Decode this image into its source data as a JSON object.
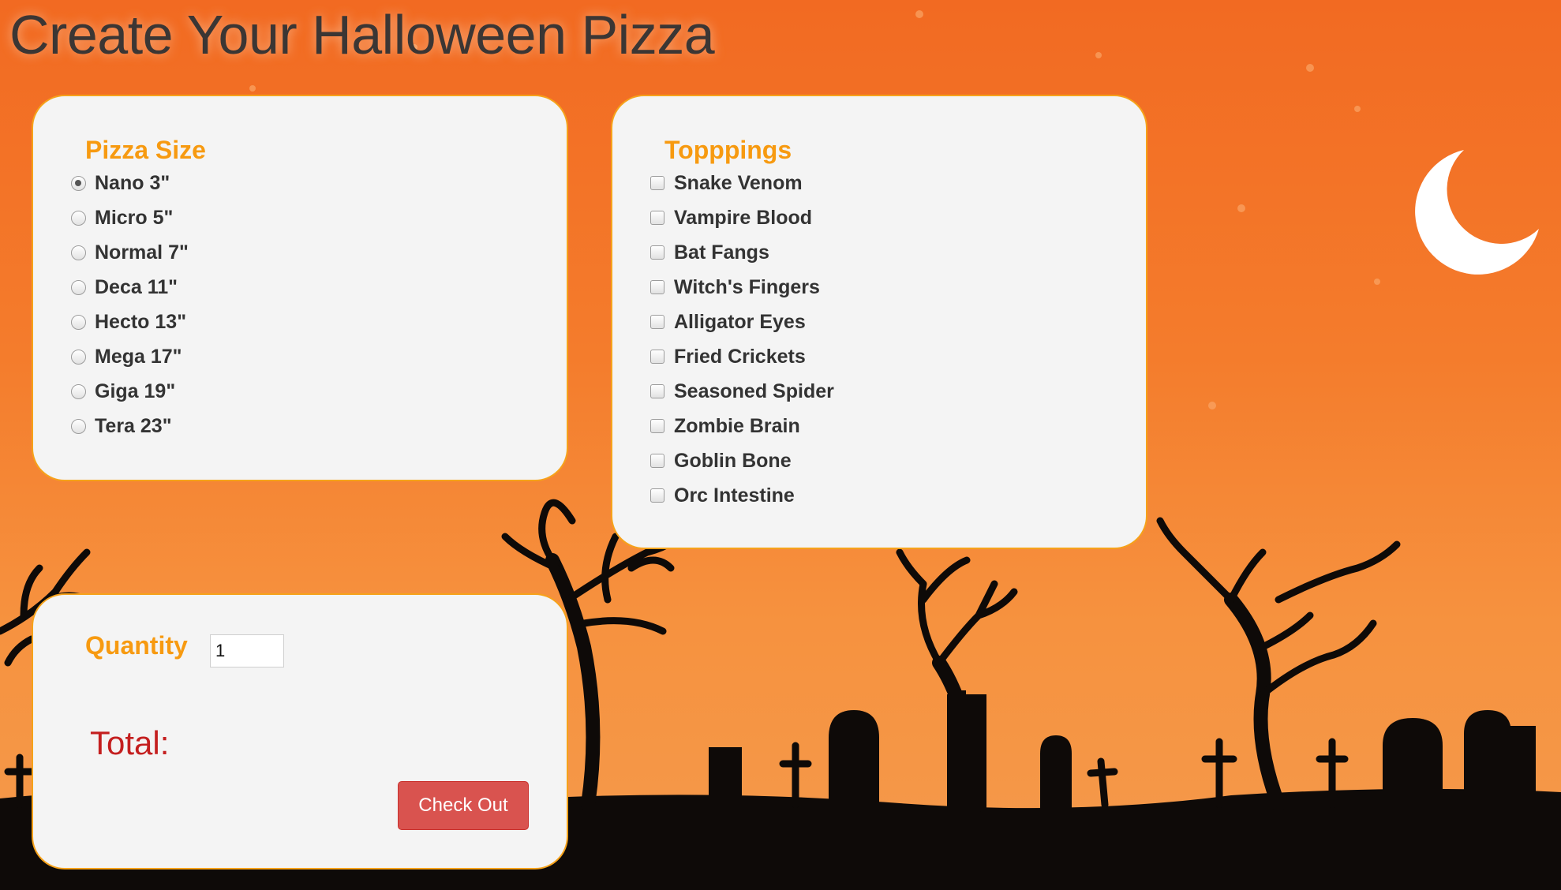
{
  "page": {
    "title": "Create Your Halloween Pizza"
  },
  "size_panel": {
    "heading": "Pizza Size",
    "selected_index": 0,
    "options": [
      "Nano 3\"",
      "Micro 5\"",
      "Normal 7\"",
      "Deca 11\"",
      "Hecto 13\"",
      "Mega 17\"",
      "Giga 19\"",
      "Tera 23\""
    ]
  },
  "toppings_panel": {
    "heading": "Topppings",
    "options": [
      "Snake Venom",
      "Vampire Blood",
      "Bat Fangs",
      "Witch's Fingers",
      "Alligator Eyes",
      "Fried Crickets",
      "Seasoned Spider",
      "Zombie Brain",
      "Goblin Bone",
      "Orc Intestine"
    ]
  },
  "order_panel": {
    "quantity_label": "Quantity",
    "quantity_value": "1",
    "total_label": "Total:",
    "checkout_label": "Check Out"
  },
  "colors": {
    "heading_orange": "#f79a10",
    "total_red": "#c41f1f",
    "button_red": "#d9534f",
    "background_orange": "#f26a22"
  },
  "icons": [
    "moon-icon",
    "tree-silhouette",
    "tombstone-silhouette"
  ]
}
